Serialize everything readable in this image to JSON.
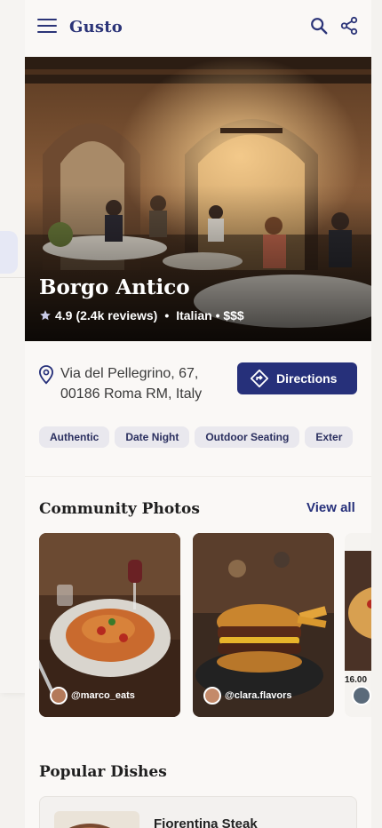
{
  "app": {
    "brand": "Gusto"
  },
  "restaurant": {
    "name": "Borgo Antico",
    "rating": "4.9",
    "reviews": "(2.4k reviews)",
    "separator": "•",
    "cuisine_price": "Italian • $$$",
    "address_line1": "Via del Pellegrino, 67,",
    "address_line2": "00186 Roma RM, Italy"
  },
  "actions": {
    "directions_label": "Directions"
  },
  "tags": [
    "Authentic",
    "Date Night",
    "Outdoor Seating",
    "Exter"
  ],
  "community": {
    "title": "Community Photos",
    "view_all": "View all",
    "photos": [
      {
        "user": "@marco_eats"
      },
      {
        "user": "@clara.flavors"
      }
    ],
    "peek_price": "16.00"
  },
  "dishes": {
    "title": "Popular Dishes",
    "items": [
      {
        "name": "Fiorentina Steak"
      }
    ]
  },
  "colors": {
    "primary": "#26307a",
    "brand": "#2b3478",
    "chip_bg": "#e9e8ee",
    "background": "#faf8f6"
  },
  "icons": [
    "menu-icon",
    "search-icon",
    "share-icon",
    "star-icon",
    "location-pin-icon",
    "directions-icon"
  ]
}
